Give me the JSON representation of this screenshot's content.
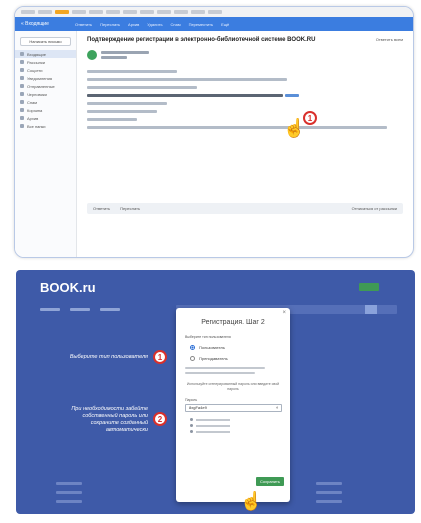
{
  "email_panel": {
    "logo": "« Входящие",
    "toolbar_actions": [
      "Ответить",
      "Переслать",
      "Архив",
      "Удалить",
      "Спам",
      "Переместить",
      "Ещё"
    ],
    "compose_label": "Написать письмо",
    "folders": [
      "Входящие",
      "Рассылки",
      "Соцсети",
      "Уведомления",
      "Отправленные",
      "Черновики",
      "Спам",
      "Корзина",
      "Архив",
      "Все папки"
    ],
    "subject": "Подтверждение регистрации в электронно-библиотечной системе BOOK.RU",
    "reply_all_label": "Ответить всем",
    "actions": {
      "reply": "Ответить",
      "forward": "Переслать",
      "spam": "Отписаться от рассылки"
    },
    "step_number": "1"
  },
  "book_panel": {
    "logo": "BOOK.ru",
    "annotation_1": "Выберите тип пользователя",
    "annotation_2": "При необходимости забейте собственный пароль или сохраните созданный автоматически",
    "step_1": "1",
    "step_2": "2",
    "modal": {
      "close": "×",
      "title": "Регистрация. Шаг 2",
      "subtitle": "Выберите тип пользователя",
      "options": [
        "Пользователь",
        "Преподаватель"
      ],
      "note": "Используйте сгенерированный пароль или введите свой пароль",
      "password_label": "Пароль",
      "password_value": "8xgFa4e9",
      "save_label": "Сохранить"
    }
  }
}
